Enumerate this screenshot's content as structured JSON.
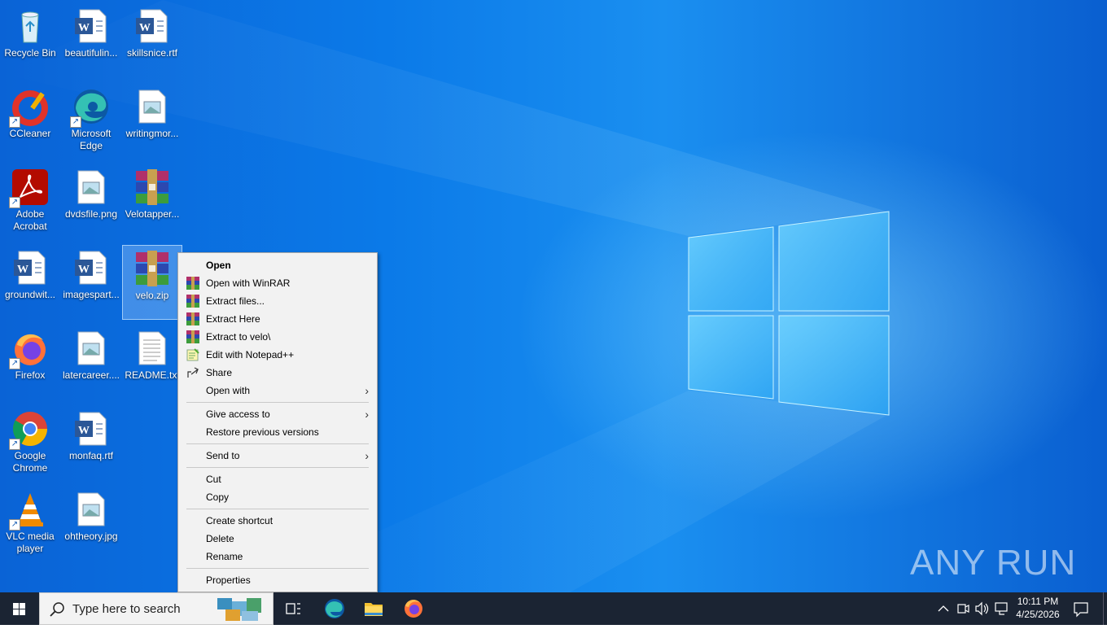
{
  "desktop": {
    "icons": [
      {
        "label": "Recycle Bin"
      },
      {
        "label": "beautifulin..."
      },
      {
        "label": "skillsnice.rtf"
      },
      {
        "label": "CCleaner"
      },
      {
        "label": "Microsoft Edge"
      },
      {
        "label": "writingmor..."
      },
      {
        "label": "Adobe Acrobat"
      },
      {
        "label": "dvdsfile.png"
      },
      {
        "label": "Velotapper..."
      },
      {
        "label": "groundwit..."
      },
      {
        "label": "imagespart..."
      },
      {
        "label": "velo.zip"
      },
      {
        "label": "Firefox"
      },
      {
        "label": "latercareer...."
      },
      {
        "label": "README.txt"
      },
      {
        "label": "Google Chrome"
      },
      {
        "label": "monfaq.rtf"
      },
      {
        "label": "VLC media player"
      },
      {
        "label": "ohtheory.jpg"
      }
    ]
  },
  "context_menu": {
    "items": [
      {
        "label": "Open"
      },
      {
        "label": "Open with WinRAR",
        "icon": "winrar-icon"
      },
      {
        "label": "Extract files...",
        "icon": "winrar-icon"
      },
      {
        "label": "Extract Here",
        "icon": "winrar-icon"
      },
      {
        "label": "Extract to velo\\",
        "icon": "winrar-icon"
      },
      {
        "label": "Edit with Notepad++",
        "icon": "notepadpp-icon"
      },
      {
        "label": "Share",
        "icon": "share-icon"
      },
      {
        "label": "Open with",
        "submenu": true
      },
      {
        "label": "Give access to",
        "submenu": true
      },
      {
        "label": "Restore previous versions"
      },
      {
        "label": "Send to",
        "submenu": true
      },
      {
        "label": "Cut"
      },
      {
        "label": "Copy"
      },
      {
        "label": "Create shortcut"
      },
      {
        "label": "Delete"
      },
      {
        "label": "Rename"
      },
      {
        "label": "Properties"
      }
    ]
  },
  "taskbar": {
    "search_placeholder": "Type here to search",
    "time": "10:11 PM",
    "date": "4/25/2026"
  },
  "watermark": "ANY RUN",
  "colors": {
    "taskbar": "#1b2433",
    "menu_bg": "#f2f2f2",
    "desktop_blue": "#0b7ae8"
  }
}
